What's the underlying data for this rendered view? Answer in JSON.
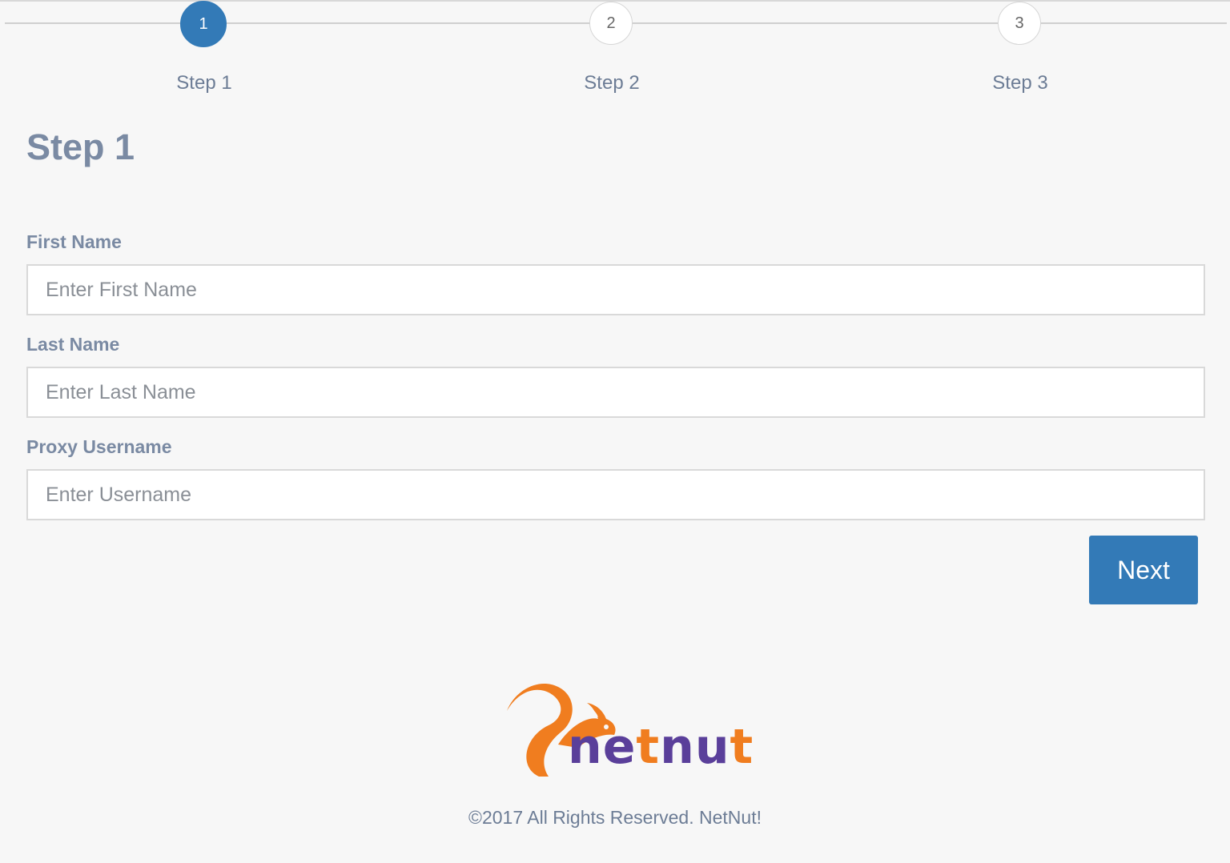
{
  "stepper": {
    "steps": [
      {
        "number": "1",
        "label": "Step 1",
        "active": true
      },
      {
        "number": "2",
        "label": "Step 2",
        "active": false
      },
      {
        "number": "3",
        "label": "Step 3",
        "active": false
      }
    ],
    "accent_color": "#337ab7"
  },
  "page": {
    "title": "Step 1"
  },
  "form": {
    "first_name": {
      "label": "First Name",
      "placeholder": "Enter First Name",
      "value": ""
    },
    "last_name": {
      "label": "Last Name",
      "placeholder": "Enter Last Name",
      "value": ""
    },
    "proxy_username": {
      "label": "Proxy Username",
      "placeholder": "Enter Username",
      "value": ""
    },
    "next_label": "Next"
  },
  "footer": {
    "logo_icon": "squirrel-logo-icon",
    "logo_text": "netnut",
    "brand_colors": {
      "orange": "#f07d1f",
      "purple": "#5a3f9a"
    },
    "copyright": "©2017 All Rights Reserved. NetNut!"
  }
}
